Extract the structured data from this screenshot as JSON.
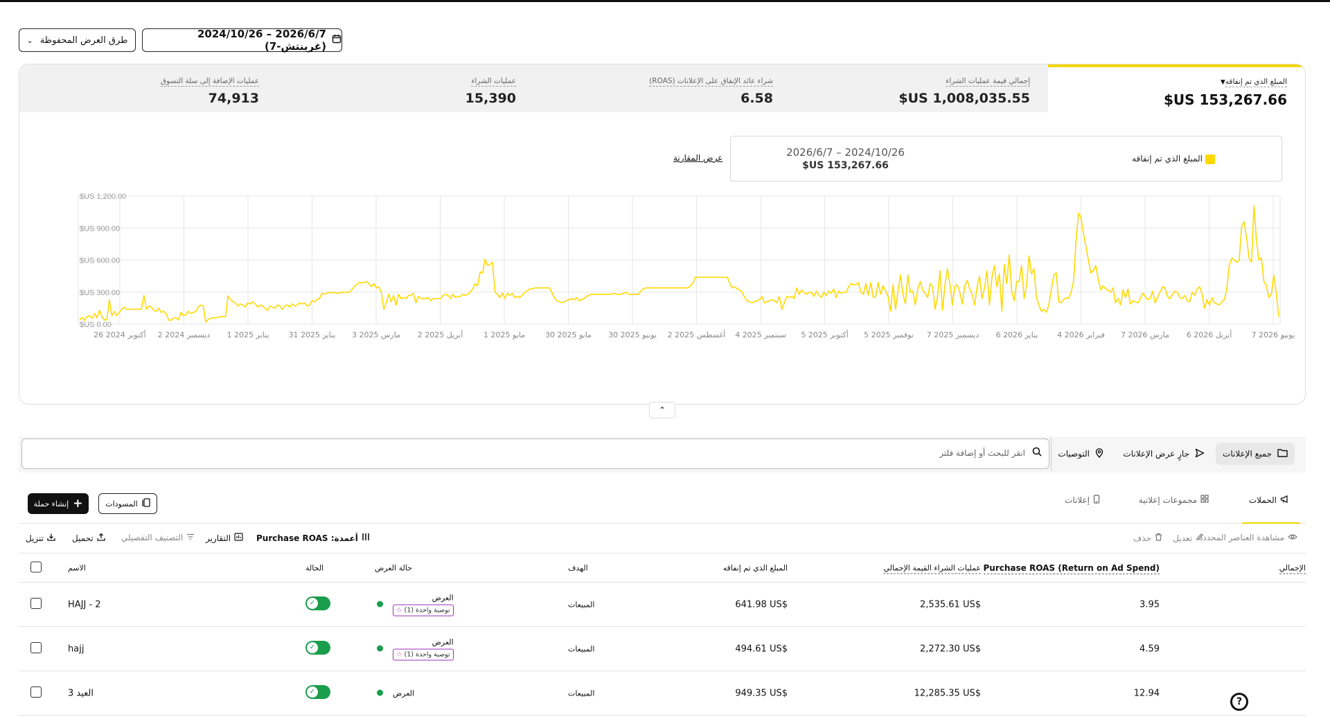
{
  "header": {
    "date_range": "2026/6/7 – 2024/10/26 (غرينتش-7)",
    "saved_views": "طرق العرض المحفوظة"
  },
  "metrics": [
    {
      "label": "المبلغ الذي تم إنفاقه",
      "value": "$US 153,267.66",
      "active": true
    },
    {
      "label": "إجمالي قيمة عمليات الشراء",
      "value": "$US 1,008,035.55"
    },
    {
      "label": "شراء عائد الإنفاق على الإعلانات (ROAS)",
      "value": "6.58"
    },
    {
      "label": "عمليات الشراء",
      "value": "15,390"
    },
    {
      "label": "عمليات الإضافة إلى سلة التسوق",
      "value": "74,913"
    }
  ],
  "legend": {
    "series": "المبلغ الذي تم إنفاقه",
    "range": "2026/6/7 – 2024/10/26",
    "total": "$US 153,267.66",
    "compare": "عرض المقارنة",
    "color": "#ffd900"
  },
  "chart_data": {
    "type": "line",
    "x_ticks": [
      "26 أكتوبر 2024",
      "2 ديسمبر 2024",
      "1 يناير 2025",
      "31 يناير 2025",
      "3 مارس 2025",
      "2 أبريل 2025",
      "1 مايو 2025",
      "30 مايو 2025",
      "30 يونيو 2025",
      "2 أغسطس 2025",
      "4 سبتمبر 2025",
      "5 أكتوبر 2025",
      "5 نوفمبر 2025",
      "7 ديسمبر 2025",
      "6 يناير 2026",
      "4 فبراير 2026",
      "7 مارس 2026",
      "6 أبريل 2026",
      "7 يونيو 2026"
    ],
    "y_ticks": [
      "$US 0.00",
      "$US 300.00",
      "$US 600.00",
      "$US 900.00",
      "$US 1,200.00"
    ],
    "ylim": [
      0,
      1200
    ],
    "grid": true,
    "color": "#ffd900",
    "series": [
      {
        "values": [
          40,
          65,
          35,
          70,
          80,
          55,
          100,
          60,
          130,
          70,
          40,
          40,
          230,
          80,
          120,
          80,
          110,
          140,
          160,
          140,
          140,
          140,
          140,
          140,
          140,
          140,
          270,
          140,
          170,
          160,
          130,
          120,
          150,
          110,
          120,
          100,
          40,
          35,
          60,
          60,
          40,
          110,
          80,
          90,
          120,
          100,
          110,
          120,
          160,
          180,
          170,
          20,
          45,
          55,
          60,
          60,
          65,
          70,
          70,
          70,
          265,
          230,
          210,
          200,
          170,
          190,
          180,
          160,
          200,
          190,
          210,
          190,
          160,
          180,
          170,
          150,
          130,
          170,
          160,
          150,
          180,
          170,
          140,
          170,
          180,
          160,
          190,
          170,
          180,
          200,
          190,
          200,
          170,
          180,
          220,
          210,
          230,
          240,
          290,
          280,
          290,
          300,
          290,
          300,
          290,
          290,
          300,
          300,
          300,
          300,
          320,
          350,
          370,
          390,
          390,
          390,
          400,
          380,
          350,
          380,
          340,
          350,
          300,
          140,
          200,
          280,
          210,
          270,
          180,
          280,
          240,
          250,
          240,
          270,
          270,
          290,
          200,
          260,
          240,
          240,
          240,
          250,
          220,
          240,
          240,
          240,
          240,
          270,
          280,
          270,
          240,
          280,
          250,
          260,
          260,
          280,
          270,
          280,
          300,
          330,
          380,
          360,
          490,
          480,
          610,
          550,
          560,
          580,
          300,
          280,
          250,
          290,
          240,
          290,
          270,
          290,
          250,
          260,
          250,
          270,
          300,
          310,
          330,
          330,
          340,
          340,
          340,
          340,
          340,
          340,
          340,
          300,
          250,
          220,
          210,
          200,
          210,
          220,
          230,
          240,
          230,
          250,
          220,
          230,
          240,
          260,
          270,
          280,
          280,
          280,
          280,
          280,
          280,
          280,
          280,
          280,
          290,
          280,
          280,
          280,
          290,
          300,
          280,
          280,
          280,
          280,
          280,
          310,
          330,
          340,
          340,
          340,
          340,
          340,
          340,
          340,
          340,
          340,
          340,
          340,
          340,
          340,
          340,
          340,
          340,
          340,
          340,
          360,
          380,
          440,
          440,
          440,
          440,
          440,
          440,
          440,
          440,
          440,
          440,
          440,
          440,
          440,
          440,
          380,
          340,
          350,
          330,
          320,
          300,
          250,
          220,
          210,
          200,
          210,
          220,
          230,
          260,
          200,
          210,
          220,
          230,
          220,
          200,
          260,
          140,
          200,
          260,
          250,
          260,
          240,
          340,
          280,
          320,
          300,
          280,
          300,
          300,
          260,
          310,
          270,
          250,
          300,
          270,
          310,
          290,
          330,
          250,
          310,
          290,
          300,
          300,
          350,
          380,
          370,
          370,
          390,
          300,
          280,
          380,
          270,
          390,
          250,
          260,
          390,
          280,
          360,
          310,
          260,
          120,
          370,
          140,
          310,
          460,
          280,
          190,
          460,
          300,
          310,
          180,
          330,
          400,
          320,
          290,
          250,
          380,
          350,
          140,
          260,
          500,
          130,
          370,
          520,
          380,
          180,
          360,
          370,
          300,
          190,
          360,
          410,
          330,
          280,
          180,
          350,
          450,
          240,
          340,
          500,
          180,
          440,
          550,
          350,
          470,
          120,
          560,
          380,
          650,
          310,
          220,
          400,
          400,
          550,
          240,
          370,
          640,
          470,
          520,
          250,
          180,
          120,
          140,
          110,
          180,
          320,
          460,
          480,
          210,
          200,
          230,
          250,
          240,
          300,
          400,
          770,
          1040,
          1000,
          850,
          730,
          600,
          480,
          500,
          550,
          420,
          320,
          360,
          330,
          320,
          300,
          340,
          200,
          240,
          180,
          320,
          250,
          330,
          190,
          220,
          210,
          200,
          240,
          290,
          260,
          230,
          240,
          310,
          200,
          250,
          300,
          350,
          340,
          260,
          240,
          280,
          310,
          300,
          250,
          240,
          270,
          220,
          210,
          300,
          270,
          330,
          350,
          280,
          150,
          230,
          180,
          250,
          200,
          190,
          180,
          210,
          230,
          330,
          550,
          620,
          600,
          580,
          600,
          920,
          960,
          800,
          620,
          580,
          1110,
          780,
          600,
          620,
          400,
          360,
          250,
          280,
          460,
          300,
          70
        ]
      }
    ]
  },
  "toolbar_nav": {
    "all_ads": "جميع الإعلانات",
    "live": "جارٍ عرض الإعلانات",
    "recommendations": "التوصيات",
    "search_placeholder": "انقر للبحث أو إضافة فلتر"
  },
  "tabs": {
    "campaigns": "الحملات",
    "ad_sets": "مجموعات إعلانية",
    "ads": "إعلانات",
    "drafts": "المسودات",
    "create": "إنشاء حملة"
  },
  "table_toolbar": {
    "view_selected": "مشاهدة العناصر المحددة",
    "edit": "تعديل",
    "delete": "حذف",
    "columns": "أعمدة: Purchase ROAS",
    "reports": "التقارير",
    "breakdown": "التصنيف التفصيلي",
    "upload": "تحميل",
    "download": "تنزيل"
  },
  "table": {
    "headers": {
      "name": "الاسم",
      "status": "الحالة",
      "delivery": "حالة العرض",
      "objective": "الهدف",
      "spend": "المبلغ الذي تم إنفاقه",
      "purchase_value": "عمليات الشراء القيمة الإجمالي",
      "roas": "Purchase ROAS (Return on Ad Spend)",
      "total": "الإجمالي"
    },
    "rows": [
      {
        "name": "HAJJ - 2",
        "delivery": "العرض",
        "recommendation": "توصية واحدة (1)",
        "objective": "المبيعات",
        "spend": "641.98 US$",
        "purchase_value": "2,535.61 US$",
        "roas": "3.95"
      },
      {
        "name": "hajj",
        "delivery": "العرض",
        "recommendation": "توصية واحدة (1)",
        "objective": "المبيعات",
        "spend": "494.61 US$",
        "purchase_value": "2,272.30 US$",
        "roas": "4.59"
      },
      {
        "name": "العيد 3",
        "delivery": "العرض",
        "recommendation": "",
        "objective": "المبيعات",
        "spend": "949.35 US$",
        "purchase_value": "12,285.35 US$",
        "roas": "12.94"
      }
    ]
  },
  "icons": {
    "calendar": "calendar-icon",
    "chevron": "chevron-down-icon",
    "folder": "folder-icon",
    "send": "send-icon",
    "pin": "location-pin-icon",
    "search": "search-icon",
    "megaphone": "megaphone-icon",
    "grid": "grid-icon",
    "phone": "phone-icon",
    "help": "help-icon"
  }
}
